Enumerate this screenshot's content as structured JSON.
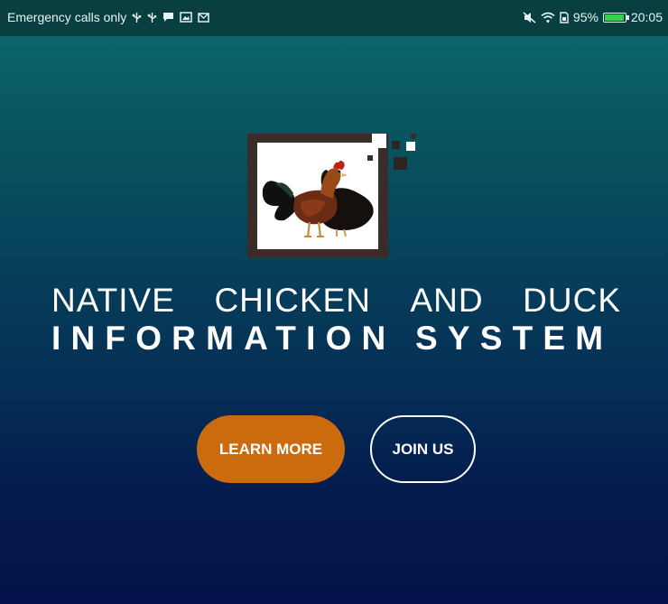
{
  "status_bar": {
    "carrier_text": "Emergency calls only",
    "left_icons": [
      "usb-icon",
      "usb-icon",
      "message-icon",
      "image-icon",
      "mail-icon"
    ],
    "right_icons": [
      "mute-icon",
      "wifi-icon",
      "sim-icon"
    ],
    "battery_percent_label": "95%",
    "battery_level": 0.95,
    "time": "20:05"
  },
  "brand": {
    "logo_icon": "rooster-and-duck-logo",
    "title_line1_words": [
      "NATIVE",
      "CHICKEN",
      "AND",
      "DUCK"
    ],
    "title_line2": "INFORMATION SYSTEM"
  },
  "actions": {
    "learn_more_label": "LEARN MORE",
    "join_us_label": "JOIN US"
  },
  "colors": {
    "background_top": "#0b6a6e",
    "background_bottom": "#03124a",
    "status_bar": "#0a3f41",
    "learn_more_button": "#cc6a0e",
    "logo_frame": "#3a2d29",
    "battery_fill": "#36d14a"
  }
}
